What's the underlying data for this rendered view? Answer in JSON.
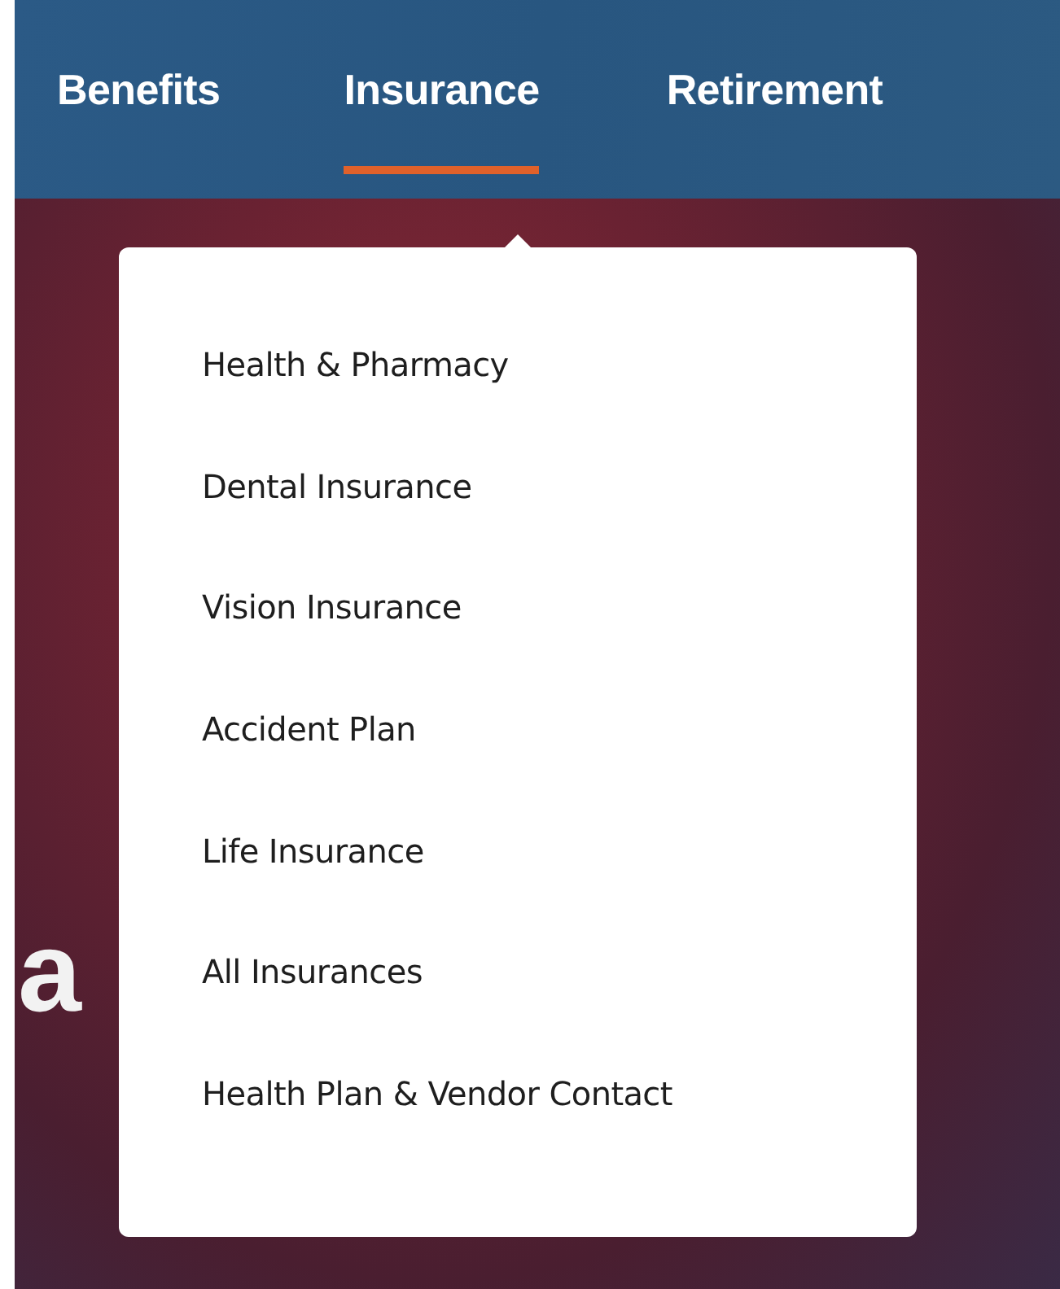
{
  "nav": {
    "tabs": [
      {
        "label": "Benefits",
        "selected": false
      },
      {
        "label": "Insurance",
        "selected": true
      },
      {
        "label": "Retirement",
        "selected": false
      }
    ]
  },
  "dropdown": {
    "items": [
      "Health & Pharmacy",
      "Dental Insurance",
      "Vision Insurance",
      "Accident Plan",
      "Life Insurance",
      "All Insurances",
      "Health Plan & Vendor Contact"
    ]
  },
  "hero": {
    "heading_fragment": "a"
  }
}
